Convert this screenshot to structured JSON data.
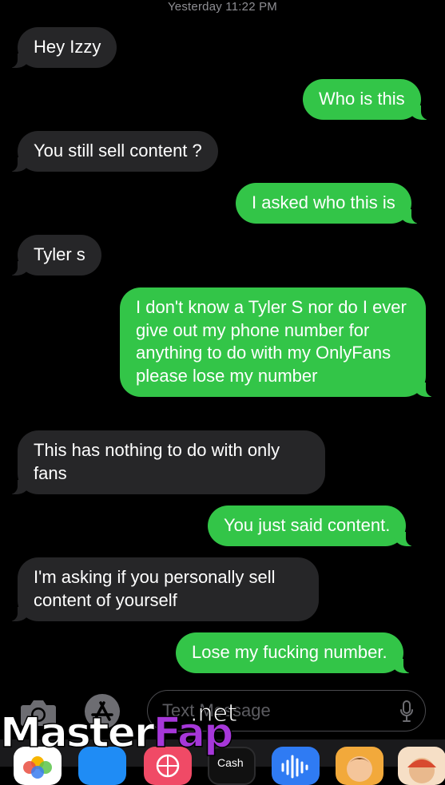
{
  "header": {
    "timestamp": "Yesterday 11:22 PM"
  },
  "messages": [
    {
      "from": "them",
      "text": "Hey Izzy"
    },
    {
      "from": "me",
      "text": "Who is this"
    },
    {
      "from": "them",
      "text": "You still sell content ?"
    },
    {
      "from": "me",
      "text": "I asked who this is"
    },
    {
      "from": "them",
      "text": "Tyler s"
    },
    {
      "from": "me",
      "text": "I don't know a Tyler S nor do I ever give out my phone number for anything to do with my OnlyFans please lose my number"
    },
    {
      "from": "them",
      "text": "This has nothing to do with only fans"
    },
    {
      "from": "me",
      "text": "You just said content."
    },
    {
      "from": "them",
      "text": "I'm asking if you personally sell content of yourself"
    },
    {
      "from": "me",
      "text": "Lose my fucking number."
    }
  ],
  "compose": {
    "placeholder": "Text Message",
    "camera_icon": "camera-icon",
    "apps_icon": "app-store-icon",
    "mic_icon": "microphone-icon"
  },
  "app_drawer": {
    "items": [
      {
        "name": "photos-app-icon"
      },
      {
        "name": "app-store-app-icon"
      },
      {
        "name": "images-app-icon"
      },
      {
        "name": "cash-app-icon",
        "label": "Cash"
      },
      {
        "name": "audio-message-app-icon"
      },
      {
        "name": "memoji-app-icon"
      },
      {
        "name": "animoji-app-icon"
      }
    ]
  },
  "watermark": {
    "text": "MasterFap",
    "part1": "Master",
    "part2": "Fap",
    "suffix": ".net"
  },
  "colors": {
    "background": "#000000",
    "incoming_bubble": "#262628",
    "outgoing_bubble": "#33c548",
    "timestamp": "#8e8e93",
    "watermark_accent": "#a637d9"
  }
}
